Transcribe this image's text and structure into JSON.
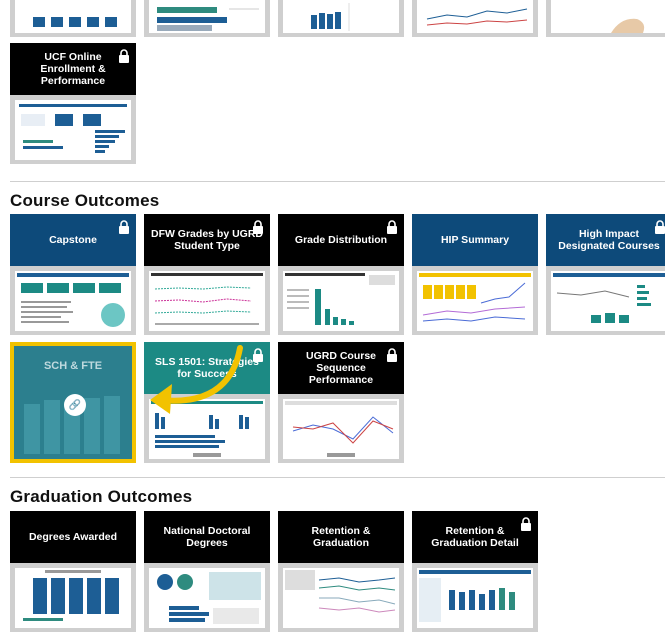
{
  "sections": {
    "course_outcomes": "Course Outcomes",
    "graduation_outcomes": "Graduation Outcomes"
  },
  "tiles": {
    "ucf_online": "UCF Online Enrollment & Performance",
    "capstone": "Capstone",
    "dfw_grades": "DFW Grades by UGRD Student Type",
    "grade_distribution": "Grade Distribution",
    "hip_summary": "HIP Summary",
    "high_impact": "High Impact Designated Courses",
    "sch_fte": "SCH & FTE",
    "sls_1501": "SLS 1501: Strategies for Success",
    "ugrd_sequence": "UGRD Course Sequence Performance",
    "degrees_awarded": "Degrees Awarded",
    "national_doctoral": "National Doctoral Degrees",
    "retention_graduation": "Retention & Graduation",
    "retention_graduation_detail": "Retention & Graduation Detail"
  },
  "icons": {
    "lock": "lock-icon",
    "link": "link-icon",
    "annotation_arrow": "yellow-curved-arrow"
  },
  "colors": {
    "black_header": "#000000",
    "blue_header": "#0d4a7a",
    "teal_header": "#1c8a84",
    "highlight": "#f2c200"
  }
}
